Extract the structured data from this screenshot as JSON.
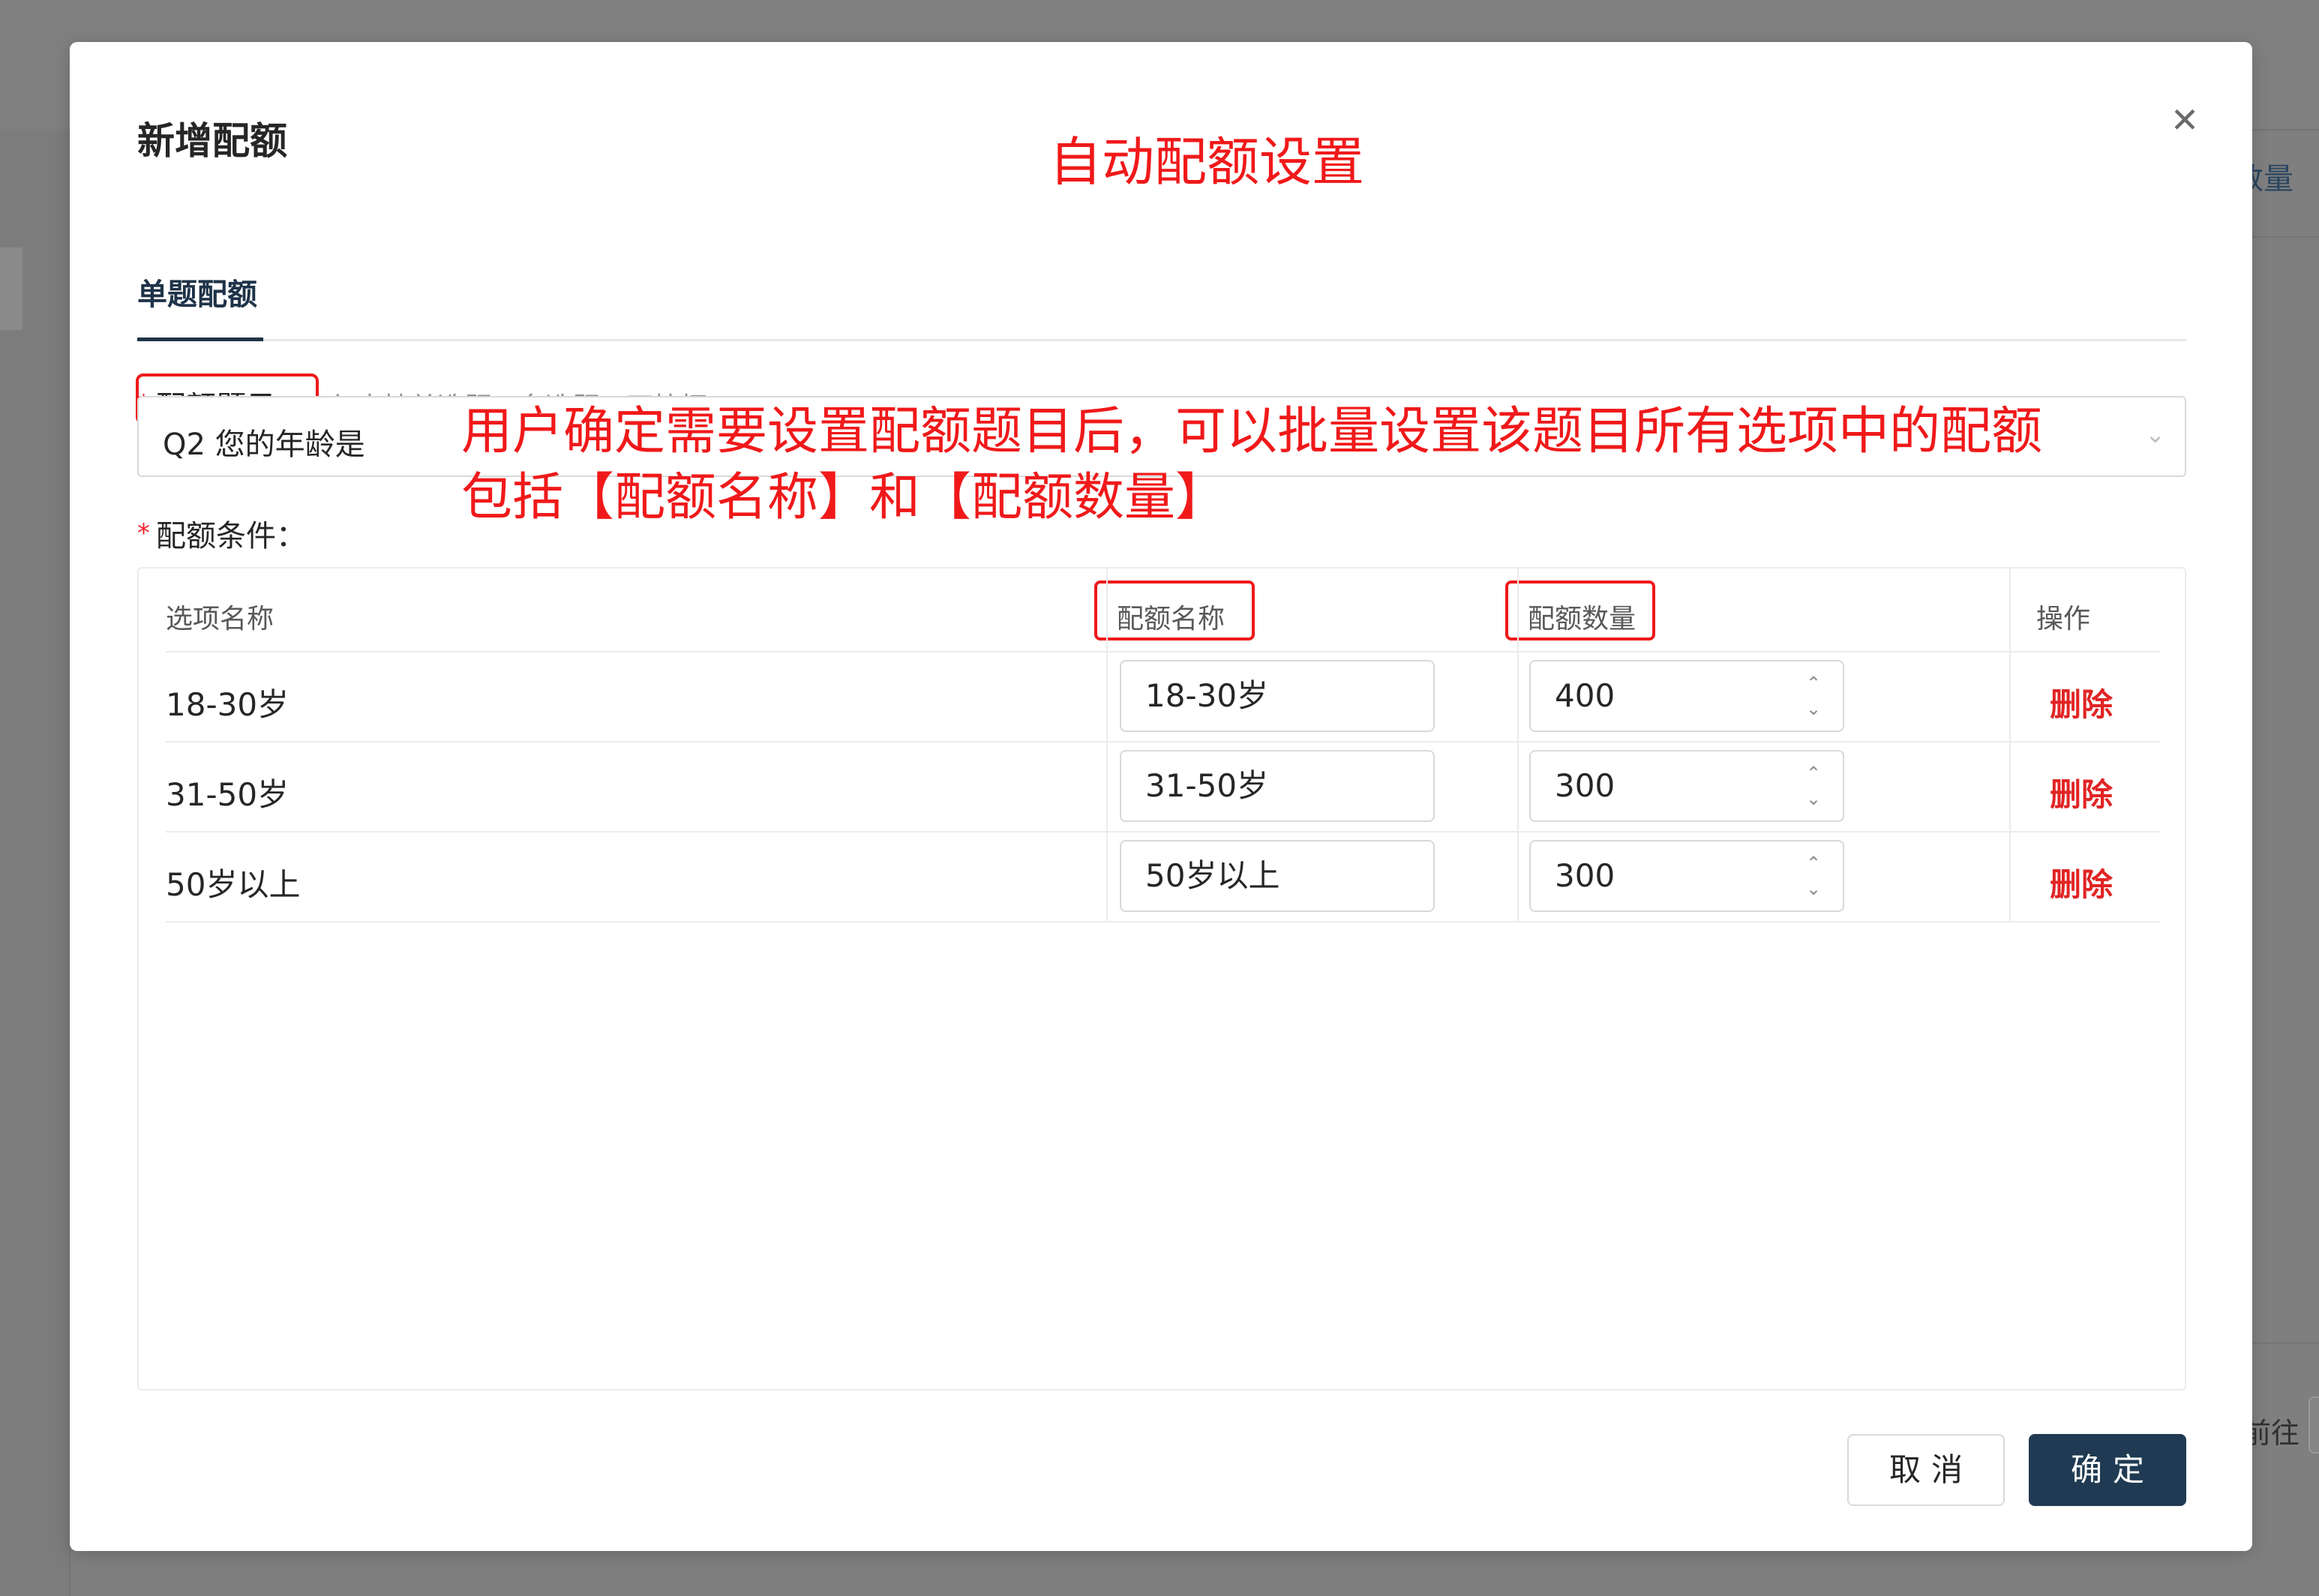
{
  "background": {
    "right_header_text": "数量",
    "right_goto_text": "前往"
  },
  "modal": {
    "title": "新增配额",
    "close_icon": "close-icon",
    "annotation_title": "自动配额设置",
    "tabs": [
      {
        "label": "单题配额",
        "active": true
      }
    ],
    "question_field": {
      "required_mark": "*",
      "label": "配额题目：",
      "hint": "(仅支持单选题、多选题、下拉框)",
      "selected_value": "Q2 您的年龄是",
      "arrow_icon": "chevron-down-icon"
    },
    "annotation_body": [
      "用户确定需要设置配额题目后，可以批量设置该题目所有选项中的配额",
      "包括【配额名称】和【配额数量】"
    ],
    "condition_field": {
      "required_mark": "*",
      "label": "配额条件："
    },
    "table": {
      "columns": [
        "选项名称",
        "配额名称",
        "配额数量",
        "操作"
      ],
      "rows": [
        {
          "option": "18-30岁",
          "quota_name": "18-30岁",
          "quota_count": "400",
          "action": "删除"
        },
        {
          "option": "31-50岁",
          "quota_name": "31-50岁",
          "quota_count": "300",
          "action": "删除"
        },
        {
          "option": "50岁以上",
          "quota_name": "50岁以上",
          "quota_count": "300",
          "action": "删除"
        }
      ]
    },
    "footer": {
      "cancel_label": "取消",
      "ok_label": "确定"
    }
  },
  "colors": {
    "accent": "#1f3a52",
    "annotation_red": "#f0191a",
    "delete_red": "#e12424",
    "overlay": "#7f7f7f"
  }
}
